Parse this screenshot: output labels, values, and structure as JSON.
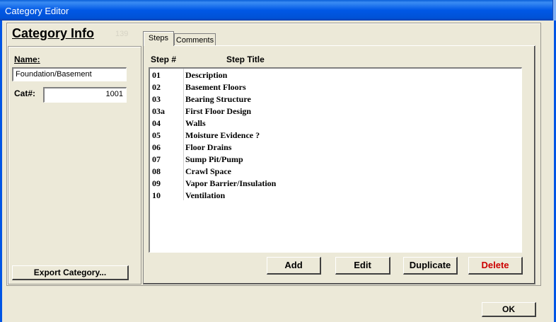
{
  "window": {
    "title": "Category Editor"
  },
  "category_info": {
    "heading": "Category Info",
    "count": "139",
    "name_label": "Name:",
    "name_value": "Foundation/Basement",
    "cat_label": "Cat#:",
    "cat_value": "1001",
    "export_button": "Export Category..."
  },
  "tabs": [
    {
      "label": "Steps",
      "active": true
    },
    {
      "label": "Comments",
      "active": false
    }
  ],
  "steps": {
    "col_step": "Step #",
    "col_title": "Step Title",
    "rows": [
      {
        "num": "01",
        "title": "Description"
      },
      {
        "num": "02",
        "title": "Basement Floors"
      },
      {
        "num": "03",
        "title": "Bearing Structure"
      },
      {
        "num": "03a",
        "title": "First Floor Design"
      },
      {
        "num": "04",
        "title": "Walls"
      },
      {
        "num": "05",
        "title": "Moisture Evidence ?"
      },
      {
        "num": "06",
        "title": "Floor Drains"
      },
      {
        "num": "07",
        "title": "Sump Pit/Pump"
      },
      {
        "num": "08",
        "title": "Crawl Space"
      },
      {
        "num": "09",
        "title": "Vapor Barrier/Insulation"
      },
      {
        "num": "10",
        "title": "Ventilation"
      }
    ],
    "buttons": {
      "add": "Add",
      "edit": "Edit",
      "duplicate": "Duplicate",
      "delete": "Delete"
    }
  },
  "ok_button": "OK",
  "colors": {
    "delete_text": "#cc0000",
    "titlebar": "#0055e5"
  }
}
